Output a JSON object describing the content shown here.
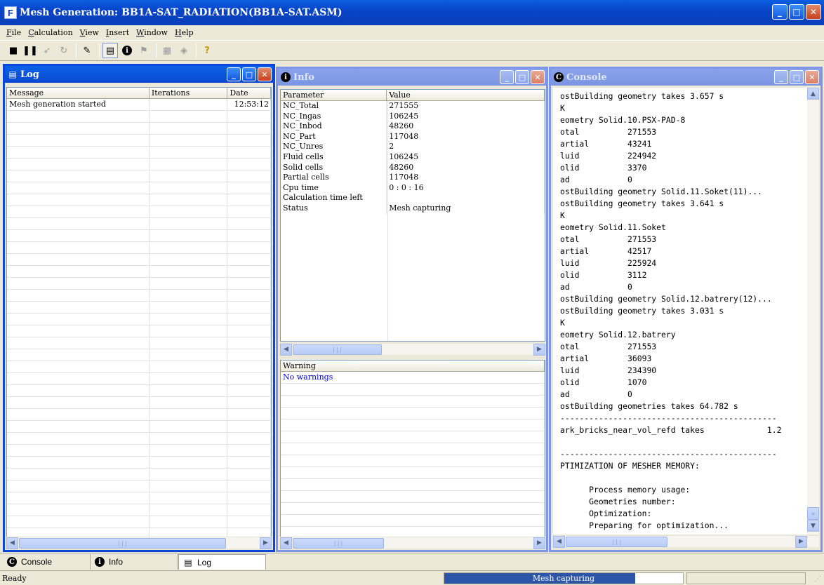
{
  "app": {
    "icon_letter": "F",
    "title": "Mesh Generation: BB1A-SAT_RADIATION(BB1A-SAT.ASM)"
  },
  "menu": [
    {
      "underline": "F",
      "rest": "ile"
    },
    {
      "underline": "C",
      "rest": "alculation"
    },
    {
      "underline": "V",
      "rest": "iew"
    },
    {
      "underline": "I",
      "rest": "nsert"
    },
    {
      "underline": "W",
      "rest": "indow"
    },
    {
      "underline": "H",
      "rest": "elp"
    }
  ],
  "log": {
    "title": "Log",
    "columns": [
      "Message",
      "Iterations",
      "Date"
    ],
    "rows": [
      {
        "message": "Mesh generation started",
        "iterations": "",
        "date": "12:53:12"
      }
    ]
  },
  "info": {
    "title": "Info",
    "columns": [
      "Parameter",
      "Value"
    ],
    "rows": [
      {
        "p": "NC_Total",
        "v": "271555"
      },
      {
        "p": "NC_Ingas",
        "v": "106245"
      },
      {
        "p": "NC_Inbod",
        "v": "48260"
      },
      {
        "p": "NC_Part",
        "v": "117048"
      },
      {
        "p": "NC_Unres",
        "v": "2"
      },
      {
        "p": "Fluid cells",
        "v": "106245"
      },
      {
        "p": "Solid cells",
        "v": "48260"
      },
      {
        "p": "Partial cells",
        "v": "117048"
      },
      {
        "p": "Cpu time",
        "v": "0 : 0 : 16"
      },
      {
        "p": "Calculation time left",
        "v": ""
      },
      {
        "p": "Status",
        "v": "Mesh capturing"
      }
    ],
    "warning_header": "Warning",
    "warnings": [
      "No warnings"
    ]
  },
  "console": {
    "title": "Console",
    "lines": [
      "ostBuilding geometry takes 3.657 s",
      "K",
      "eometry Solid.10.PSX-PAD-8",
      "otal          271553",
      "artial        43241",
      "luid          224942",
      "olid          3370",
      "ad            0",
      "ostBuilding geometry Solid.11.Soket(11)...",
      "ostBuilding geometry takes 3.641 s",
      "K",
      "eometry Solid.11.Soket",
      "otal          271553",
      "artial        42517",
      "luid          225924",
      "olid          3112",
      "ad            0",
      "ostBuilding geometry Solid.12.batrery(12)...",
      "ostBuilding geometry takes 3.031 s",
      "K",
      "eometry Solid.12.batrery",
      "otal          271553",
      "artial        36093",
      "luid          234390",
      "olid          1070",
      "ad            0",
      "ostBuilding geometries takes 64.782 s",
      "---------------------------------------------",
      "ark_bricks_near_vol_refd takes             1.2",
      "",
      "---------------------------------------------",
      "PTIMIZATION OF MESHER MEMORY:",
      "",
      "      Process memory usage:",
      "      Geometries number:",
      "      Optimization:",
      "      Preparing for optimization..."
    ]
  },
  "tabs": [
    "Console",
    "Info",
    "Log"
  ],
  "status": {
    "text": "Ready",
    "progress_label": "Mesh capturing",
    "progress_fraction": 0.8
  },
  "colors": {
    "title_blue": "#0a46d8",
    "inactive_blue": "#7f95e8",
    "progress": "#2c55a8",
    "warning_text": "#0000e0"
  }
}
